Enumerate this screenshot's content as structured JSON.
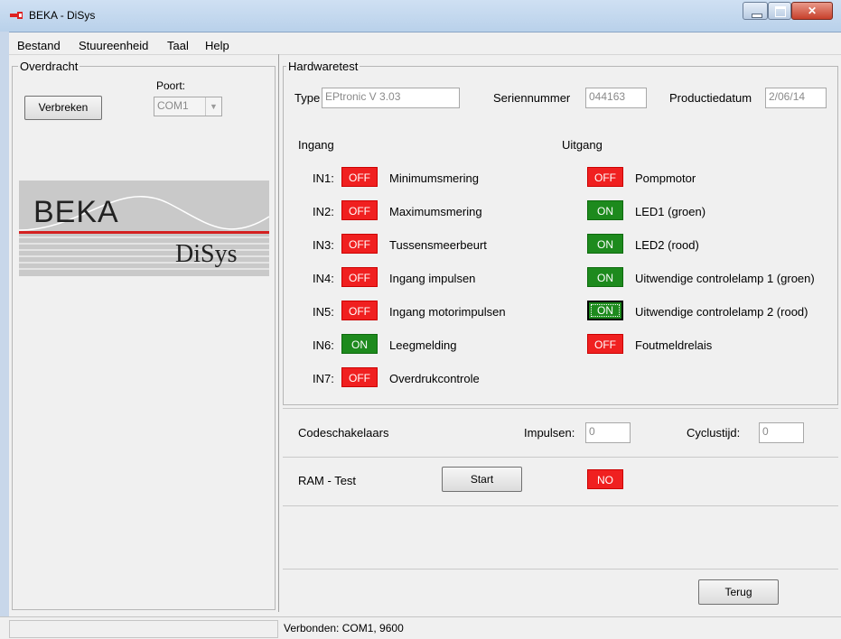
{
  "window": {
    "title": "BEKA - DiSys"
  },
  "menu": {
    "items": [
      "Bestand",
      "Stuureenheid",
      "Taal",
      "Help"
    ]
  },
  "transfer": {
    "legend": "Overdracht",
    "port_label": "Poort:",
    "port_value": "COM1",
    "disconnect_label": "Verbreken"
  },
  "logo": {
    "brand": "BEKA",
    "product": "DiSys"
  },
  "hardware": {
    "legend": "Hardwaretest",
    "type_label": "Type",
    "type_value": "EPtronic V 3.03",
    "serial_label": "Seriennummer",
    "serial_value": "044163",
    "date_label": "Productiedatum",
    "date_value": "2/06/14"
  },
  "inputs": {
    "heading": "Ingang",
    "items": [
      {
        "id": "IN1:",
        "state": "OFF",
        "label": "Minimumsmering"
      },
      {
        "id": "IN2:",
        "state": "OFF",
        "label": "Maximumsmering"
      },
      {
        "id": "IN3:",
        "state": "OFF",
        "label": "Tussensmeerbeurt"
      },
      {
        "id": "IN4:",
        "state": "OFF",
        "label": "Ingang impulsen"
      },
      {
        "id": "IN5:",
        "state": "OFF",
        "label": "Ingang motorimpulsen"
      },
      {
        "id": "IN6:",
        "state": "ON",
        "label": "Leegmelding"
      },
      {
        "id": "IN7:",
        "state": "OFF",
        "label": "Overdrukcontrole"
      }
    ]
  },
  "outputs": {
    "heading": "Uitgang",
    "items": [
      {
        "state": "OFF",
        "label": "Pompmotor"
      },
      {
        "state": "ON",
        "label": "LED1 (groen)"
      },
      {
        "state": "ON",
        "label": "LED2 (rood)"
      },
      {
        "state": "ON",
        "label": "Uitwendige controlelamp 1 (groen)"
      },
      {
        "state": "ON",
        "label": "Uitwendige controlelamp 2 (rood)"
      },
      {
        "state": "OFF",
        "label": "Foutmeldrelais"
      }
    ]
  },
  "code_switches": {
    "label": "Codeschakelaars",
    "pulses_label": "Impulsen:",
    "pulses_value": "0",
    "cycle_label": "Cyclustijd:",
    "cycle_value": "0"
  },
  "ram_test": {
    "label": "RAM - Test",
    "start_label": "Start",
    "result": "NO"
  },
  "back_label": "Terug",
  "status": {
    "text": "Verbonden: COM1,  9600"
  },
  "colors": {
    "off": "#f02020",
    "on": "#1d8a1d",
    "logo_red": "#d42020",
    "logo_grey": "#c9c9c9"
  }
}
